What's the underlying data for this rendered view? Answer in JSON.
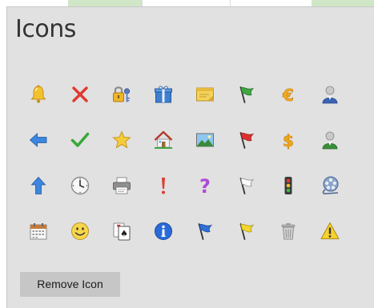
{
  "panel": {
    "title": "Icons"
  },
  "actions": {
    "remove_label": "Remove Icon"
  },
  "icons": [
    [
      "bell-icon",
      "close-x-icon",
      "lock-key-icon",
      "gift-icon",
      "note-icon",
      "flag-green-icon",
      "euro-icon",
      "user-blue-icon"
    ],
    [
      "arrow-left-icon",
      "check-icon",
      "star-icon",
      "home-icon",
      "picture-icon",
      "flag-red-icon",
      "dollar-icon",
      "user-green-icon"
    ],
    [
      "arrow-up-icon",
      "clock-icon",
      "printer-icon",
      "exclamation-icon",
      "question-icon",
      "flag-white-icon",
      "traffic-light-icon",
      "film-reel-icon"
    ],
    [
      "calendar-icon",
      "smiley-icon",
      "playing-cards-icon",
      "info-icon",
      "flag-blue-icon",
      "flag-yellow-icon",
      "trash-icon",
      "warning-icon"
    ]
  ],
  "colors": {
    "panel_bg": "#e1e1e1",
    "button_bg": "#c6c6c6",
    "accent_green_cell": "#cfe6c7"
  }
}
